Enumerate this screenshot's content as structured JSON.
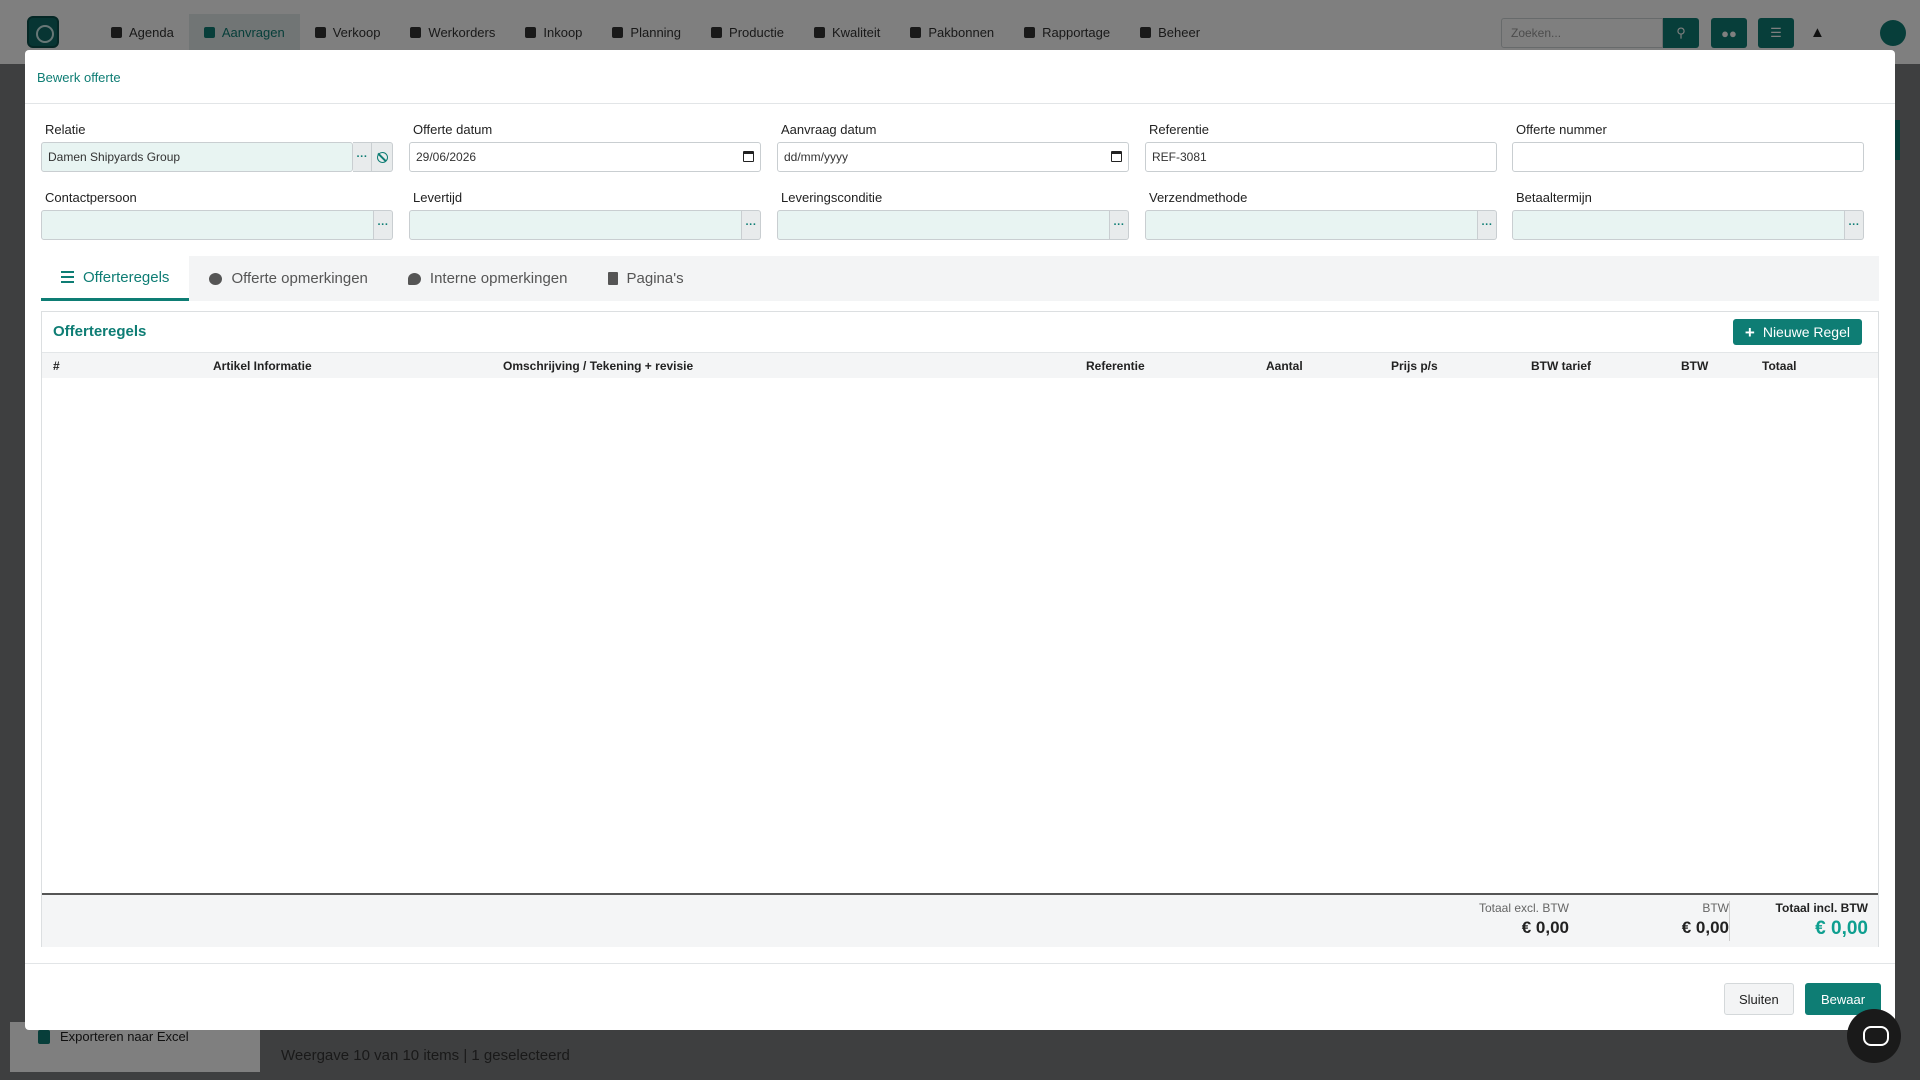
{
  "nav": {
    "items": [
      {
        "label": "Agenda",
        "icon": "calendar-icon",
        "active": false
      },
      {
        "label": "Aanvragen",
        "icon": "store-icon",
        "active": true
      },
      {
        "label": "Verkoop",
        "icon": "file-icon",
        "active": false
      },
      {
        "label": "Werkorders",
        "icon": "wrench-icon",
        "active": false
      },
      {
        "label": "Inkoop",
        "icon": "cart-icon",
        "active": false
      },
      {
        "label": "Planning",
        "icon": "calendar-grid-icon",
        "active": false
      },
      {
        "label": "Productie",
        "icon": "factory-icon",
        "active": false
      },
      {
        "label": "Kwaliteit",
        "icon": "bar-chart-icon",
        "active": false
      },
      {
        "label": "Pakbonnen",
        "icon": "truck-icon",
        "active": false
      },
      {
        "label": "Rapportage",
        "icon": "report-icon",
        "active": false
      },
      {
        "label": "Beheer",
        "icon": "gear-icon",
        "active": false
      }
    ],
    "search_placeholder": "Zoeken...",
    "accent_color": "#0e7d74"
  },
  "background": {
    "export_label": "Exporteren naar Excel",
    "footer_text": "Weergave 10 van 10 items | 1 geselecteerd"
  },
  "modal": {
    "title": "Bewerk offerte",
    "fields": {
      "relatie": {
        "label": "Relatie",
        "value": "Damen Shipyards Group"
      },
      "offerte_datum": {
        "label": "Offerte datum",
        "value": "29/06/2026"
      },
      "aanvraag_datum": {
        "label": "Aanvraag datum",
        "value": "dd/mm/yyyy"
      },
      "referentie": {
        "label": "Referentie",
        "value": "REF-3081"
      },
      "offerte_nummer": {
        "label": "Offerte nummer",
        "value": ""
      },
      "contactpersoon": {
        "label": "Contactpersoon",
        "value": ""
      },
      "levertijd": {
        "label": "Levertijd",
        "value": ""
      },
      "leveringsconditie": {
        "label": "Leveringsconditie",
        "value": ""
      },
      "verzendmethode": {
        "label": "Verzendmethode",
        "value": ""
      },
      "betaaltermijn": {
        "label": "Betaaltermijn",
        "value": ""
      }
    },
    "addon_label": "···",
    "tabs": [
      {
        "label": "Offerteregels",
        "icon": "list-icon",
        "active": true
      },
      {
        "label": "Offerte opmerkingen",
        "icon": "comment-icon",
        "active": false
      },
      {
        "label": "Interne opmerkingen",
        "icon": "comments-icon",
        "active": false
      },
      {
        "label": "Pagina's",
        "icon": "document-icon",
        "active": false
      }
    ],
    "panel": {
      "title": "Offerteregels",
      "new_button": "Nieuwe Regel",
      "columns": [
        "#",
        "Artikel Informatie",
        "Omschrijving / Tekening + revisie",
        "Referentie",
        "Aantal",
        "Prijs p/s",
        "BTW tarief",
        "BTW",
        "Totaal"
      ],
      "rows": []
    },
    "totals": {
      "excl_label": "Totaal excl. BTW",
      "excl_value": "€ 0,00",
      "btw_label": "BTW",
      "btw_value": "€ 0,00",
      "incl_label": "Totaal incl. BTW",
      "incl_value": "€ 0,00"
    },
    "buttons": {
      "close": "Sluiten",
      "save": "Bewaar"
    }
  }
}
